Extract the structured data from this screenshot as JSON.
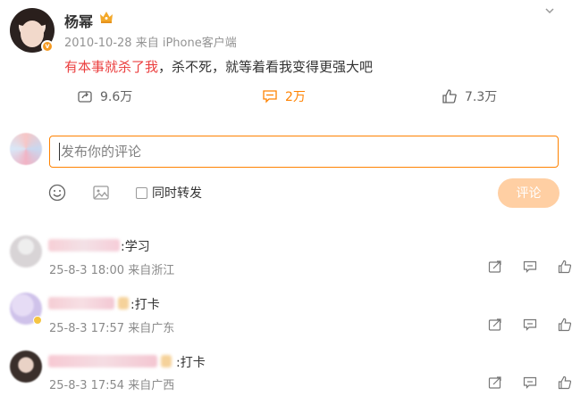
{
  "post": {
    "author": "杨幂",
    "date": "2010-10-28",
    "source": "来自 iPhone客户端",
    "text_highlight": "有本事就杀了我",
    "text_rest": "，杀不死，就等着看我变得更强大吧",
    "shares": "9.6万",
    "comments": "2万",
    "likes": "7.3万"
  },
  "composer": {
    "placeholder": "发布你的评论",
    "repost_label": "同时转发",
    "submit_label": "评论"
  },
  "comments": [
    {
      "text": ":学习",
      "time": "25-8-3 18:00",
      "location": "来自浙江"
    },
    {
      "text": ":打卡",
      "time": "25-8-3 17:57",
      "location": "来自广东"
    },
    {
      "text": ":打卡",
      "time": "25-8-3 17:54",
      "location": "来自广西"
    }
  ],
  "colors": {
    "accent": "#ff8200",
    "highlight": "#eb3f3f",
    "submit_disabled": "#ffcfa3"
  },
  "icons": [
    "crown-icon",
    "chevron-down-icon",
    "share-icon",
    "comment-icon",
    "like-icon",
    "emoji-icon",
    "image-icon",
    "repost-icon",
    "reply-icon"
  ]
}
